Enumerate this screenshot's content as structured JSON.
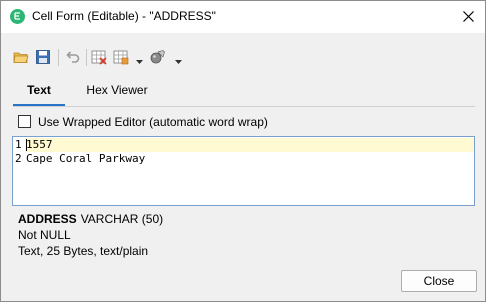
{
  "window": {
    "title": "Cell Form (Editable) - \"ADDRESS\""
  },
  "toolbar": {
    "buttons": [
      {
        "icon": "open-folder-icon"
      },
      {
        "icon": "save-disk-icon"
      },
      {
        "icon": "undo-icon"
      },
      {
        "icon": "grid-delete-icon"
      },
      {
        "icon": "grid-options-icon"
      },
      {
        "icon": "wrench-ball-icon"
      }
    ]
  },
  "tabs": [
    {
      "label": "Text",
      "active": true
    },
    {
      "label": "Hex Viewer",
      "active": false
    }
  ],
  "wrap_option": {
    "label": "Use Wrapped Editor (automatic word wrap)",
    "checked": false
  },
  "editor": {
    "lines": [
      {
        "num": "1",
        "text": "1557"
      },
      {
        "num": "2",
        "text": "Cape Coral Parkway"
      }
    ]
  },
  "info": {
    "field_name": "ADDRESS",
    "field_type": "VARCHAR (50)",
    "nullability": "Not NULL",
    "content_summary": "Text, 25 Bytes, text/plain"
  },
  "footer": {
    "close_label": "Close"
  },
  "colors": {
    "app_icon": "#2bb673",
    "tab_underline": "#2a73c8",
    "line_highlight": "#fffad2",
    "editor_border": "#7aa0d0"
  }
}
